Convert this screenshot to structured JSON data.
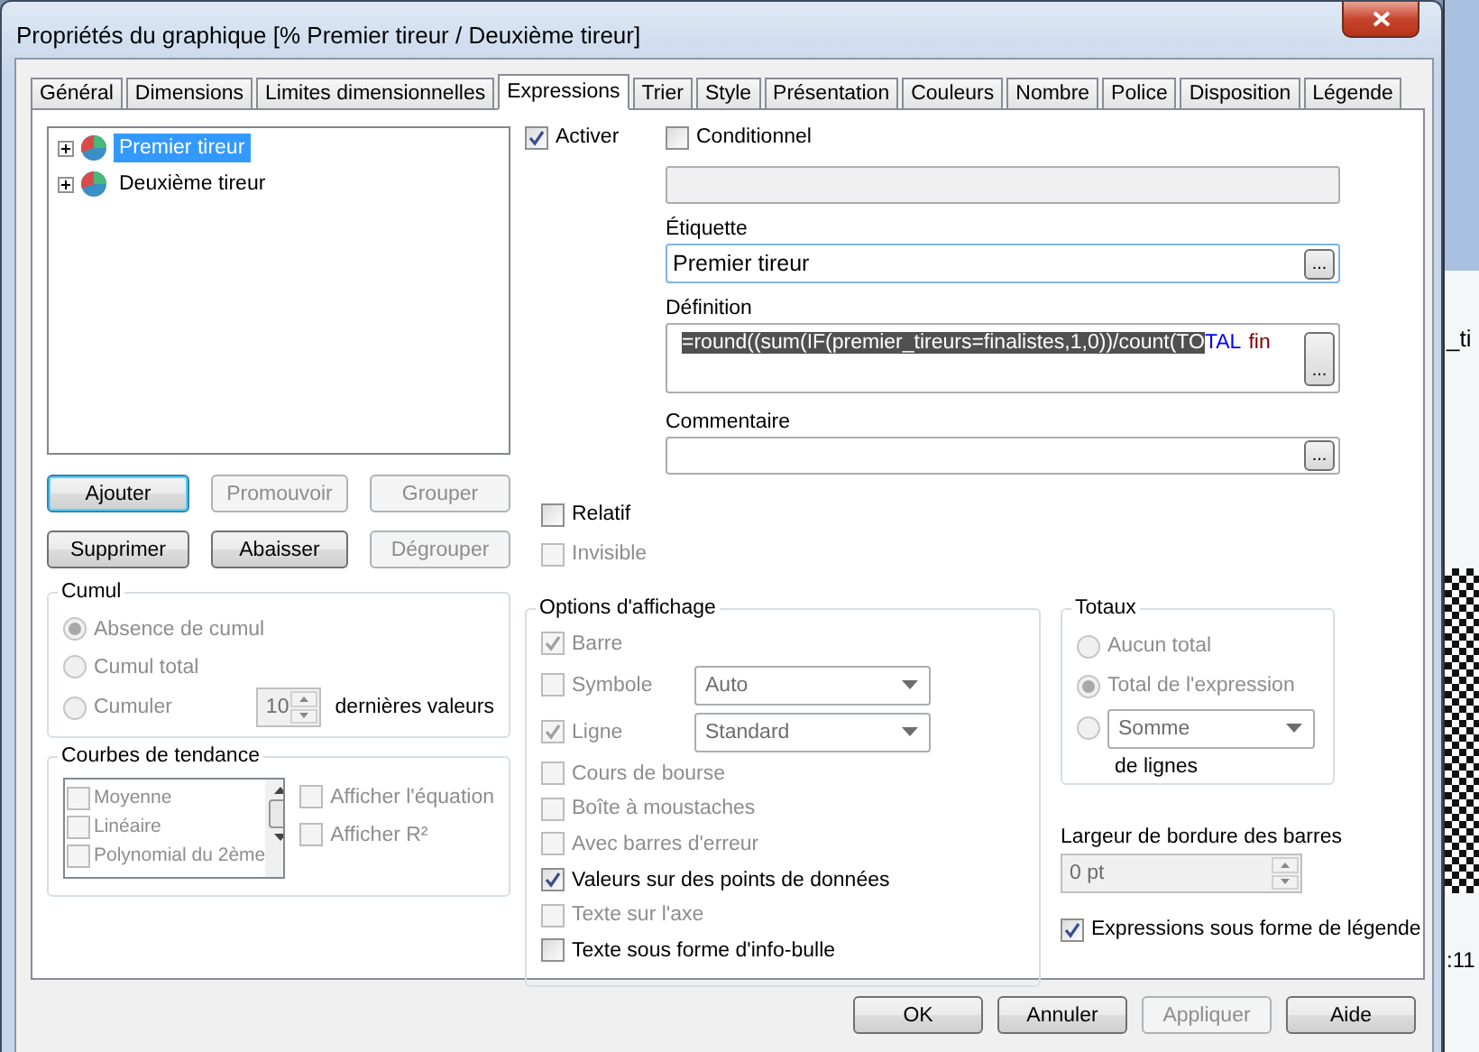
{
  "window": {
    "title": "Propriétés du graphique [% Premier tireur / Deuxième tireur]"
  },
  "tabs": [
    {
      "label": "Général",
      "selected": false
    },
    {
      "label": "Dimensions",
      "selected": false
    },
    {
      "label": "Limites dimensionnelles",
      "selected": false
    },
    {
      "label": "Expressions",
      "selected": true
    },
    {
      "label": "Trier",
      "selected": false
    },
    {
      "label": "Style",
      "selected": false
    },
    {
      "label": "Présentation",
      "selected": false
    },
    {
      "label": "Couleurs",
      "selected": false
    },
    {
      "label": "Nombre",
      "selected": false
    },
    {
      "label": "Police",
      "selected": false
    },
    {
      "label": "Disposition",
      "selected": false
    },
    {
      "label": "Légende",
      "selected": false
    }
  ],
  "expressions": [
    {
      "label": "Premier tireur",
      "selected": true
    },
    {
      "label": "Deuxième tireur",
      "selected": false
    }
  ],
  "expression_buttons": [
    {
      "label": "Ajouter",
      "disabled": false,
      "focused": true
    },
    {
      "label": "Promouvoir",
      "disabled": true,
      "focused": false
    },
    {
      "label": "Grouper",
      "disabled": true,
      "focused": false
    },
    {
      "label": "Supprimer",
      "disabled": false,
      "focused": false
    },
    {
      "label": "Abaisser",
      "disabled": false,
      "focused": false
    },
    {
      "label": "Dégrouper",
      "disabled": true,
      "focused": false
    }
  ],
  "cumul": {
    "title": "Cumul",
    "options": [
      {
        "label": "Absence de cumul",
        "selected": true,
        "disabled": true
      },
      {
        "label": "Cumul total",
        "selected": false,
        "disabled": true
      },
      {
        "label": "Cumuler",
        "selected": false,
        "disabled": true
      }
    ],
    "steps": "10",
    "steps_suffix": "dernières valeurs"
  },
  "trend": {
    "title": "Courbes de tendance",
    "items": [
      {
        "label": "Moyenne",
        "checked": false
      },
      {
        "label": "Linéaire",
        "checked": false
      },
      {
        "label": "Polynomial du 2ème",
        "checked": false
      }
    ],
    "options": [
      {
        "label": "Afficher l'équation",
        "checked": false
      },
      {
        "label": "Afficher R²",
        "checked": false
      }
    ]
  },
  "activer": {
    "label": "Activer",
    "checked": true
  },
  "conditionnel": {
    "label": "Conditionnel",
    "checked": false
  },
  "etiquette": {
    "label": "Étiquette",
    "value": "Premier tireur",
    "browse": "..."
  },
  "definition": {
    "label": "Définition",
    "selected_text": "=round((sum(IF(premier_tireurs=finalistes,1,0))/count(TO",
    "tokens": [
      {
        "text": "TAL",
        "kind": "keyword"
      },
      {
        "text": "fin",
        "kind": "field"
      }
    ],
    "browse": "..."
  },
  "commentaire": {
    "label": "Commentaire",
    "browse": "..."
  },
  "relatif": {
    "label": "Relatif",
    "checked": false,
    "disabled": false
  },
  "invisible": {
    "label": "Invisible",
    "checked": false,
    "disabled": true
  },
  "display_options": {
    "title": "Options d'affichage",
    "items": [
      {
        "label": "Barre",
        "checked": true,
        "disabled": true
      },
      {
        "label": "Symbole",
        "checked": false,
        "disabled": true,
        "dropdown": "Auto"
      },
      {
        "label": "Ligne",
        "checked": true,
        "disabled": true,
        "dropdown": "Standard"
      },
      {
        "label": "Cours de bourse",
        "checked": false,
        "disabled": true
      },
      {
        "label": "Boîte à moustaches",
        "checked": false,
        "disabled": true
      },
      {
        "label": "Avec barres d'erreur",
        "checked": false,
        "disabled": true
      },
      {
        "label": "Valeurs sur des points de données",
        "checked": true,
        "disabled": false
      },
      {
        "label": "Texte sur l'axe",
        "checked": false,
        "disabled": true
      },
      {
        "label": "Texte sous forme d'info-bulle",
        "checked": false,
        "disabled": false
      }
    ]
  },
  "totals": {
    "title": "Totaux",
    "options": [
      {
        "kind": "label",
        "label": "Aucun total",
        "selected": false,
        "disabled": true
      },
      {
        "kind": "label",
        "label": "Total de l'expression",
        "selected": true,
        "disabled": true
      },
      {
        "kind": "dropdown",
        "label": "Somme",
        "selected": false,
        "disabled": true
      }
    ],
    "suffix": "de lignes"
  },
  "bar_border": {
    "label": "Largeur de bordure des barres",
    "value": "0 pt"
  },
  "legend_option": {
    "label": "Expressions sous forme de légende",
    "checked": true
  },
  "footer_buttons": [
    {
      "label": "OK",
      "disabled": false
    },
    {
      "label": "Annuler",
      "disabled": false
    },
    {
      "label": "Appliquer",
      "disabled": true
    },
    {
      "label": "Aide",
      "disabled": false
    }
  ],
  "background_fragments": [
    "_ti",
    ":11"
  ]
}
